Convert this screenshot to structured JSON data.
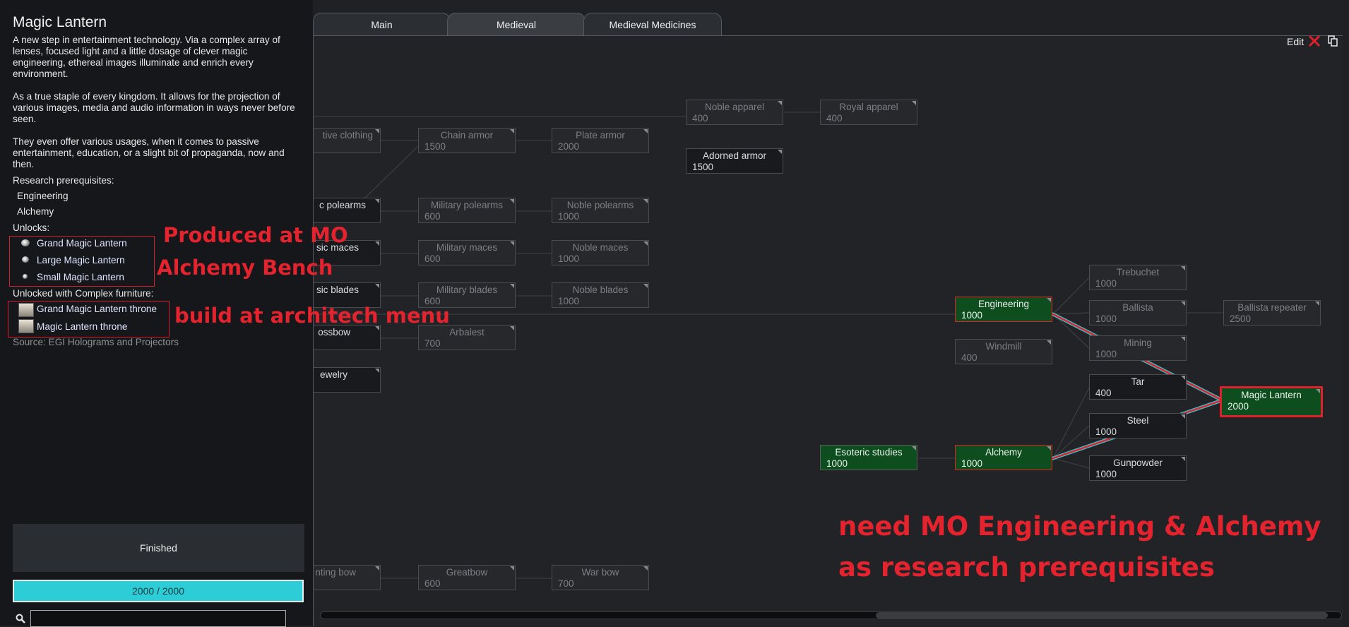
{
  "research_panel": {
    "title": "Magic Lantern",
    "description_1": "A new step in entertainment technology. Via a complex array of lenses, focused light and a little dosage of clever magic engineering, ethereal images illuminate and enrich every environment.",
    "description_2": "As a true staple of every kingdom. It allows for the projection of various images, media and audio information in ways never before seen.",
    "description_3": "They even offer various usages, when it comes to passive entertainment, education, or a slight bit of propaganda, now and then.",
    "prereq_label": "Research prerequisites:",
    "prerequisites": [
      "Engineering",
      "Alchemy"
    ],
    "unlocks_label": "Unlocks:",
    "unlocks": [
      "Grand Magic Lantern",
      "Large Magic Lantern",
      "Small Magic Lantern"
    ],
    "furniture_label": "Unlocked with Complex furniture:",
    "furniture": [
      "Grand Magic Lantern throne",
      "Magic Lantern throne"
    ],
    "source": "Source:  EGI Holograms and Projectors",
    "status": "Finished",
    "progress_text": "2000 / 2000",
    "progress_fraction": 1.0,
    "search_value": ""
  },
  "tabs": [
    {
      "label": "Main",
      "active": false
    },
    {
      "label": "Medieval",
      "active": true
    },
    {
      "label": "Medieval Medicines",
      "active": false
    }
  ],
  "toolbar": {
    "edit_label": "Edit",
    "close_icon": "close-icon",
    "copy_icon": "copy-icon"
  },
  "nodes": [
    {
      "name": "Noble apparel",
      "cost": "400",
      "state": "dim"
    },
    {
      "name": "Royal apparel",
      "cost": "400",
      "state": "dim"
    },
    {
      "name": "tive clothing",
      "cost": "",
      "state": "dim"
    },
    {
      "name": "Chain armor",
      "cost": "1500",
      "state": "dim"
    },
    {
      "name": "Plate armor",
      "cost": "2000",
      "state": "dim"
    },
    {
      "name": "Adorned armor",
      "cost": "1500",
      "state": "avail"
    },
    {
      "name": "c polearms",
      "cost": "",
      "state": "avail"
    },
    {
      "name": "Military polearms",
      "cost": "600",
      "state": "dim"
    },
    {
      "name": "Noble polearms",
      "cost": "1000",
      "state": "dim"
    },
    {
      "name": "sic maces",
      "cost": "",
      "state": "avail"
    },
    {
      "name": "Military maces",
      "cost": "600",
      "state": "dim"
    },
    {
      "name": "Noble maces",
      "cost": "1000",
      "state": "dim"
    },
    {
      "name": "sic blades",
      "cost": "",
      "state": "avail"
    },
    {
      "name": "Military blades",
      "cost": "600",
      "state": "dim"
    },
    {
      "name": "Noble blades",
      "cost": "1000",
      "state": "dim"
    },
    {
      "name": "ossbow",
      "cost": "",
      "state": "avail"
    },
    {
      "name": "Arbalest",
      "cost": "700",
      "state": "dim"
    },
    {
      "name": "ewelry",
      "cost": "",
      "state": "avail"
    },
    {
      "name": "Trebuchet",
      "cost": "1000",
      "state": "dim"
    },
    {
      "name": "Engineering",
      "cost": "1000",
      "state": "done"
    },
    {
      "name": "Ballista",
      "cost": "1000",
      "state": "dim"
    },
    {
      "name": "Ballista repeater",
      "cost": "2500",
      "state": "dim"
    },
    {
      "name": "Windmill",
      "cost": "400",
      "state": "dim"
    },
    {
      "name": "Mining",
      "cost": "1000",
      "state": "dim"
    },
    {
      "name": "Tar",
      "cost": "400",
      "state": "avail"
    },
    {
      "name": "Magic Lantern",
      "cost": "2000",
      "state": "done"
    },
    {
      "name": "Steel",
      "cost": "1000",
      "state": "avail"
    },
    {
      "name": "Esoteric studies",
      "cost": "1000",
      "state": "done"
    },
    {
      "name": "Alchemy",
      "cost": "1000",
      "state": "done"
    },
    {
      "name": "Gunpowder",
      "cost": "1000",
      "state": "avail"
    },
    {
      "name": "nting bow",
      "cost": "",
      "state": "dim"
    },
    {
      "name": "Greatbow",
      "cost": "600",
      "state": "dim"
    },
    {
      "name": "War bow",
      "cost": "700",
      "state": "dim"
    }
  ],
  "annotations": {
    "produced_line1": "Produced  at MO",
    "produced_line2": "Alchemy Bench",
    "build_note": "build at architech menu",
    "need_line1": "need MO Engineering & Alchemy",
    "need_line2": "as research prerequisites"
  },
  "colors": {
    "highlight_red": "#e3232d",
    "researched_green": "#0d4d1e",
    "progress_cyan": "#2ccdd6"
  }
}
